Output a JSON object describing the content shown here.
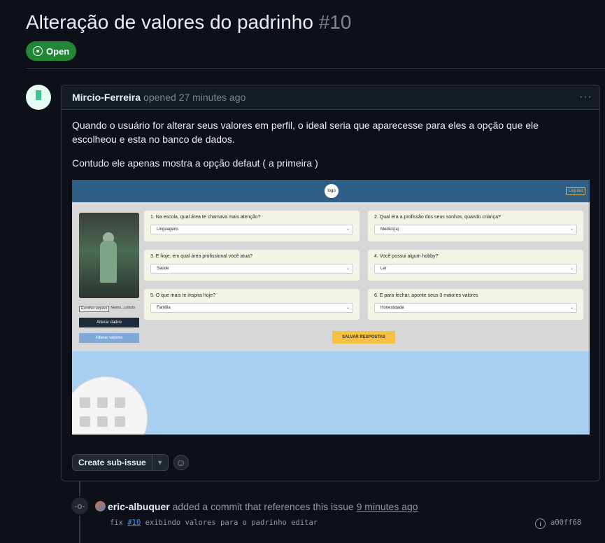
{
  "issue": {
    "title": "Alteração de valores do padrinho",
    "number": "#10",
    "state": "Open"
  },
  "comment": {
    "author": "Mircio-Ferreira",
    "meta": "opened 27 minutes ago",
    "menu_icon": "kebab-horizontal-icon",
    "paragraphs": [
      "Quando o usuário for alterar seus valores em perfil, o ideal seria que aparecesse para eles a opção que ele escolheou e esta no banco de dados.",
      "Contudo ele apenas mostra a opção defaut ( a primeira )"
    ],
    "screenshot": {
      "logo": "logo",
      "logout": "Log out",
      "file_button": "Escolher arquivo",
      "file_status": "Nenhu...colhido",
      "btn_alterar_dados": "Alterar dados",
      "btn_alterar_valores": "Alterar valores",
      "questions": [
        {
          "label": "1. Na escola, qual área te chamava mais atenção?",
          "value": "Linguagens"
        },
        {
          "label": "2. Qual era a profissão dos seus sonhos, quando criança?",
          "value": "Médico(a)"
        },
        {
          "label": "3. E hoje, em qual área profissional você atua?",
          "value": "Saúde"
        },
        {
          "label": "4. Você possui algum hobby?",
          "value": "Ler"
        },
        {
          "label": "5. O que mais te inspira hoje?",
          "value": "Família"
        },
        {
          "label": "6. E para fechar, aponte seus 3 maiores valores",
          "value": "Honestidade"
        }
      ],
      "save": "SALVAR RESPOSTAS"
    },
    "create_subissue": "Create sub-issue"
  },
  "timeline": {
    "actor": "eric-albuquer",
    "action": "added a commit that references this issue",
    "when": "9 minutes ago",
    "commit_prefix": "fix",
    "commit_ref": "#10",
    "commit_message": "exibindo valores para o padrinho editar",
    "commit_sha": "a00ff68"
  },
  "colors": {
    "background": "#0d1117",
    "open_badge": "#238636",
    "border": "#30363d",
    "link": "#4493f8"
  }
}
